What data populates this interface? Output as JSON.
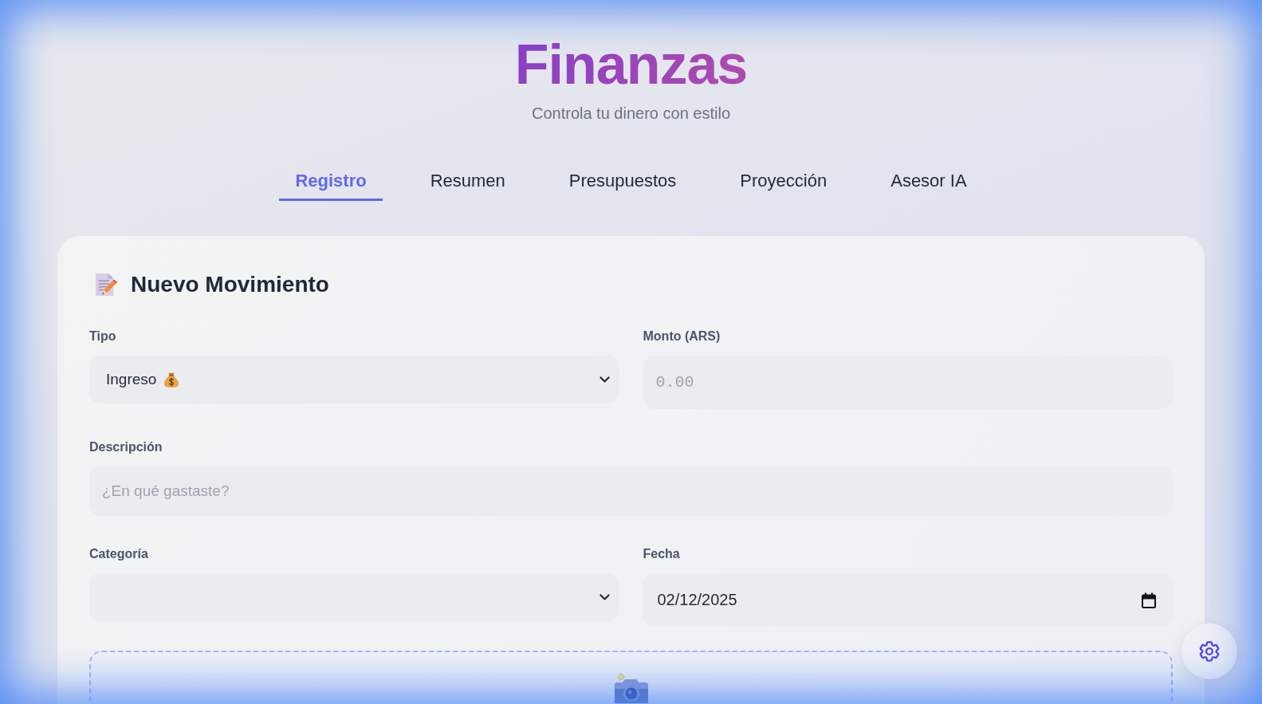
{
  "header": {
    "title": "Finanzas",
    "subtitle": "Controla tu dinero con estilo"
  },
  "tabs": [
    {
      "label": "Registro",
      "selected": true
    },
    {
      "label": "Resumen",
      "selected": false
    },
    {
      "label": "Presupuestos",
      "selected": false
    },
    {
      "label": "Proyección",
      "selected": false
    },
    {
      "label": "Asesor IA",
      "selected": false
    }
  ],
  "form": {
    "title": "Nuevo Movimiento",
    "rows": [
      [
        {
          "kind": "select",
          "label": "Tipo",
          "value": "Ingreso"
        },
        {
          "kind": "number",
          "label": "Monto (ARS)",
          "placeholder": "0.00"
        }
      ],
      [
        {
          "kind": "text",
          "label": "Descripción",
          "placeholder": "¿En qué gastaste?"
        }
      ],
      [
        {
          "kind": "select",
          "label": "Categoría"
        },
        {
          "kind": "date",
          "label": "Fecha",
          "value": "02/12/2025"
        }
      ]
    ]
  }
}
